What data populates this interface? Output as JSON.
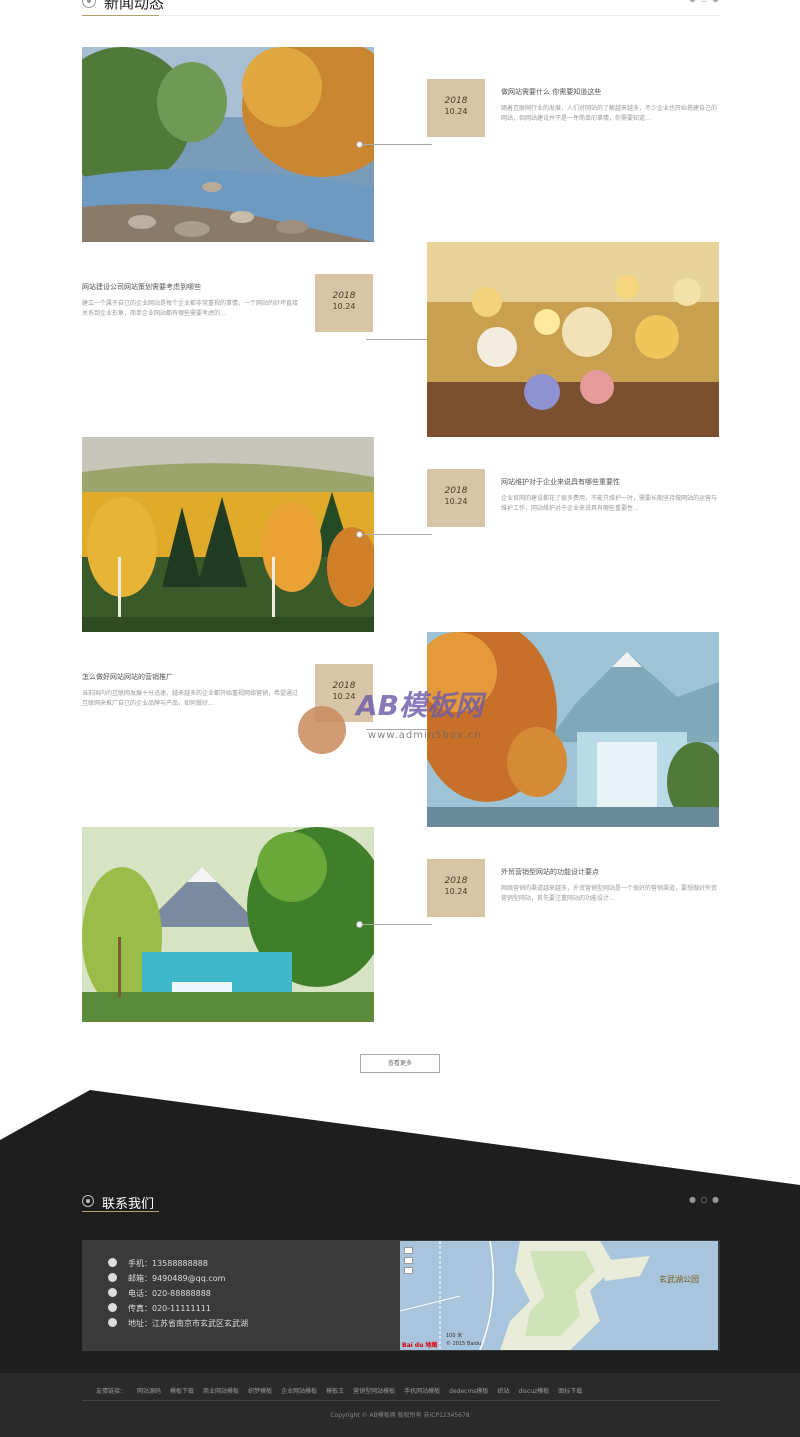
{
  "news": {
    "title": "新闻动态",
    "items": [
      {
        "year": "2018",
        "date": "10.24",
        "title": "做网站需要什么 你需要知道这些",
        "desc": "随着互联网行业的发展，人们对网站的了解越来越多，不少企业也开始搭建自己的网站，但网站建设并不是一件简单的事情，你需要知道..."
      },
      {
        "year": "2018",
        "date": "10.24",
        "title": "网站建设公司网站策划需要考虑到哪些",
        "desc": "建立一个属于自己的企业网站是每个企业都非常重视的事情，一个网站的好坏直接关系到企业形象，简单企业网站都有哪些需要考虑的..."
      },
      {
        "year": "2018",
        "date": "10.24",
        "title": "网站维护对于企业来说具有哪些重要性",
        "desc": "企业官网的建设都花了很多费用，不能只维护一时，需要长期坚持做网站的运营与维护工作，网站维护对于企业来说具有哪些重要性..."
      },
      {
        "year": "2018",
        "date": "10.24",
        "title": "怎么做好网站网站的营销推广",
        "desc": "当前国内的互联网发展十分迅速，越来越多的企业都开始重视网络营销，希望通过互联网来推广自己的企业品牌与产品，如何做好..."
      },
      {
        "year": "2018",
        "date": "10.24",
        "title": "外贸营销型网站的功能设计要点",
        "desc": "网络营销的渠道越来越多，外贸营销型网站是一个很好的营销渠道，要想做好外贸营销型网站，首先要注重网站的功能设计..."
      }
    ],
    "more_label": "查看更多"
  },
  "watermark": {
    "brand": "AB模板网",
    "url": "www.admin5box.cn"
  },
  "contact": {
    "title": "联系我们",
    "items": [
      {
        "icon": "user-icon",
        "text": "手机：13588888888"
      },
      {
        "icon": "mail-icon",
        "text": "邮箱：9490489@qq.com"
      },
      {
        "icon": "phone-icon",
        "text": "电话：020-88888888"
      },
      {
        "icon": "fax-icon",
        "text": "传真：020-11111111"
      },
      {
        "icon": "location-icon",
        "text": "地址：江苏省南京市玄武区玄武湖"
      }
    ],
    "map": {
      "label": "玄武湖公园",
      "scale": "100 米",
      "copyright": "© 2015 Baidu",
      "brand": "Bai du 地图"
    }
  },
  "footer": {
    "links_title": "友情链接：",
    "links": [
      "网站源码",
      "模板下载",
      "商业网站模板",
      "织梦模板",
      "企业网站模板",
      "模板王",
      "营销型网站模板",
      "手机网站模板",
      "dedecms模板",
      "织站",
      "discuz模板",
      "图标下载"
    ],
    "copyright": "Copyright © AB模板网 版权所有 苏ICP12345678"
  },
  "colors": {
    "accent": "#b89c6a",
    "date_box": "#d8c5a8",
    "footer_dark": "#1e1e1e",
    "contact_box": "#3a3a3a"
  }
}
